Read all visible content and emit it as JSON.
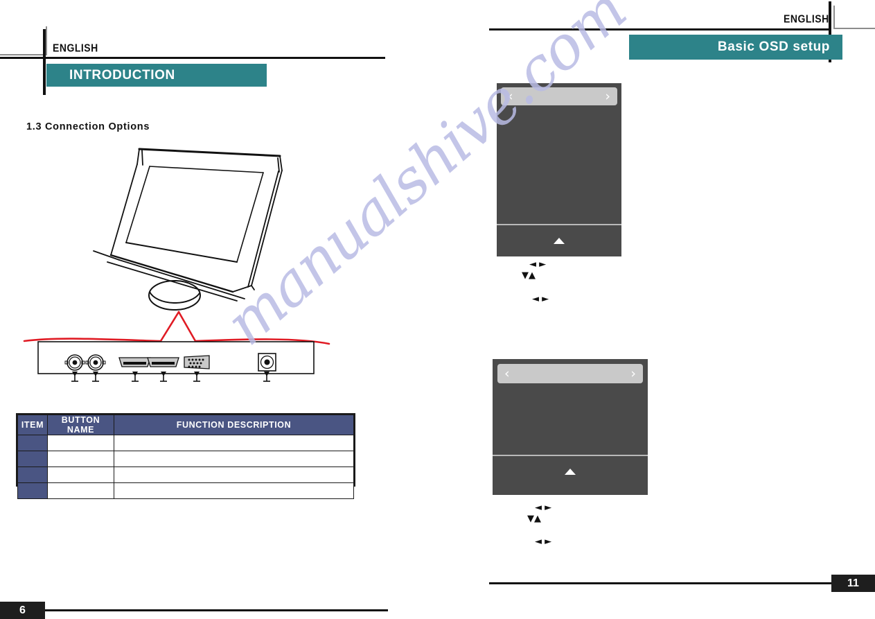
{
  "spread": {
    "left_page": {
      "language_label": "ENGLISH",
      "section_banner": "INTRODUCTION",
      "subheading": "1.3 Connection Options",
      "page_number": "6",
      "illustration": {
        "monitor_name": "lcd-monitor-line-drawing",
        "connector_panel_name": "rear-connector-panel-drawing",
        "ports": [
          {
            "name": "bnc-connector-1",
            "label": ""
          },
          {
            "name": "bnc-connector-2",
            "label": ""
          },
          {
            "name": "hdmi-port-1",
            "label": ""
          },
          {
            "name": "hdmi-port-2",
            "label": ""
          },
          {
            "name": "vga-port",
            "label": ""
          },
          {
            "name": "dc-power-jack",
            "label": ""
          }
        ]
      },
      "table": {
        "headers": [
          "ITEM",
          "BUTTON NAME",
          "FUNCTION DESCRIPTION"
        ],
        "rows": [
          {
            "item": "",
            "button_name": "",
            "function_description": ""
          },
          {
            "item": "",
            "button_name": "",
            "function_description": ""
          },
          {
            "item": "",
            "button_name": "",
            "function_description": ""
          },
          {
            "item": "",
            "button_name": "",
            "function_description": ""
          }
        ]
      }
    },
    "right_page": {
      "language_label": "ENGLISH",
      "section_banner": "Basic OSD setup",
      "page_number": "11",
      "osd_panels": [
        {
          "name": "osd-panel-top",
          "prev_icon": "‹",
          "next_icon": "›",
          "title": "",
          "body_text": "",
          "footer_icon": "▲",
          "hints": [
            {
              "icons": "◄  ►",
              "text": ""
            },
            {
              "icons": "▼▲",
              "text": ""
            },
            {
              "icons": "◄  ►",
              "text": ""
            }
          ]
        },
        {
          "name": "osd-panel-bottom",
          "prev_icon": "‹",
          "next_icon": "›",
          "title": "",
          "body_text": "",
          "footer_icon": "▲",
          "hints": [
            {
              "icons": "◄  ►",
              "text": ""
            },
            {
              "icons": "▼▲",
              "text": ""
            },
            {
              "icons": "◄  ►",
              "text": ""
            }
          ]
        }
      ]
    }
  },
  "watermark": {
    "text": "manualshive.com"
  },
  "colors": {
    "teal_banner": "#2d8389",
    "table_header_blue": "#4a5583",
    "osd_panel_gray": "#4a4a4a",
    "osd_headerbar_gray": "#c9c9c9",
    "rule_black": "#111111",
    "accent_red": "#e01b24",
    "watermark_lavender": "#b9bbe4"
  }
}
